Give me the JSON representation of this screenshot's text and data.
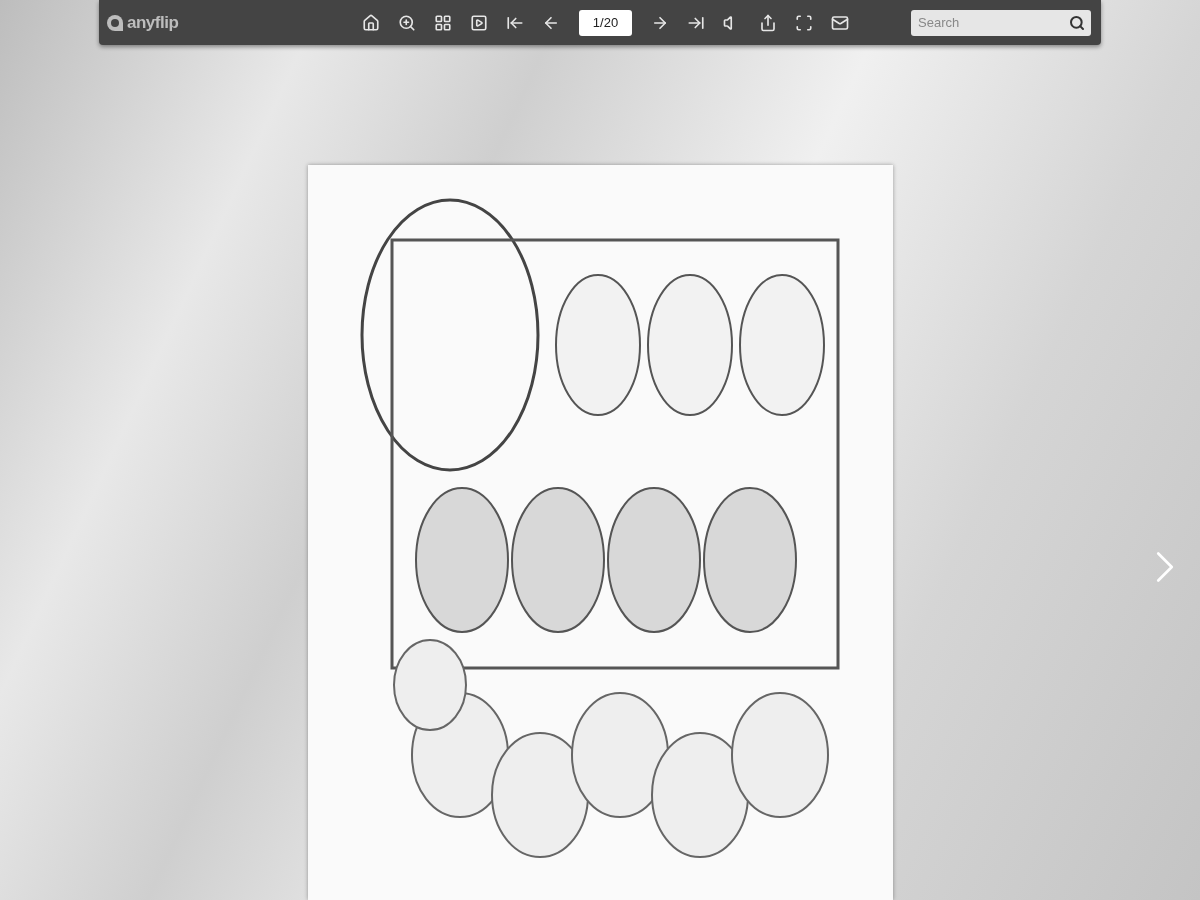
{
  "logo": {
    "text": "anyflip"
  },
  "page_field": {
    "value": "1/20"
  },
  "search": {
    "placeholder": "Search"
  }
}
